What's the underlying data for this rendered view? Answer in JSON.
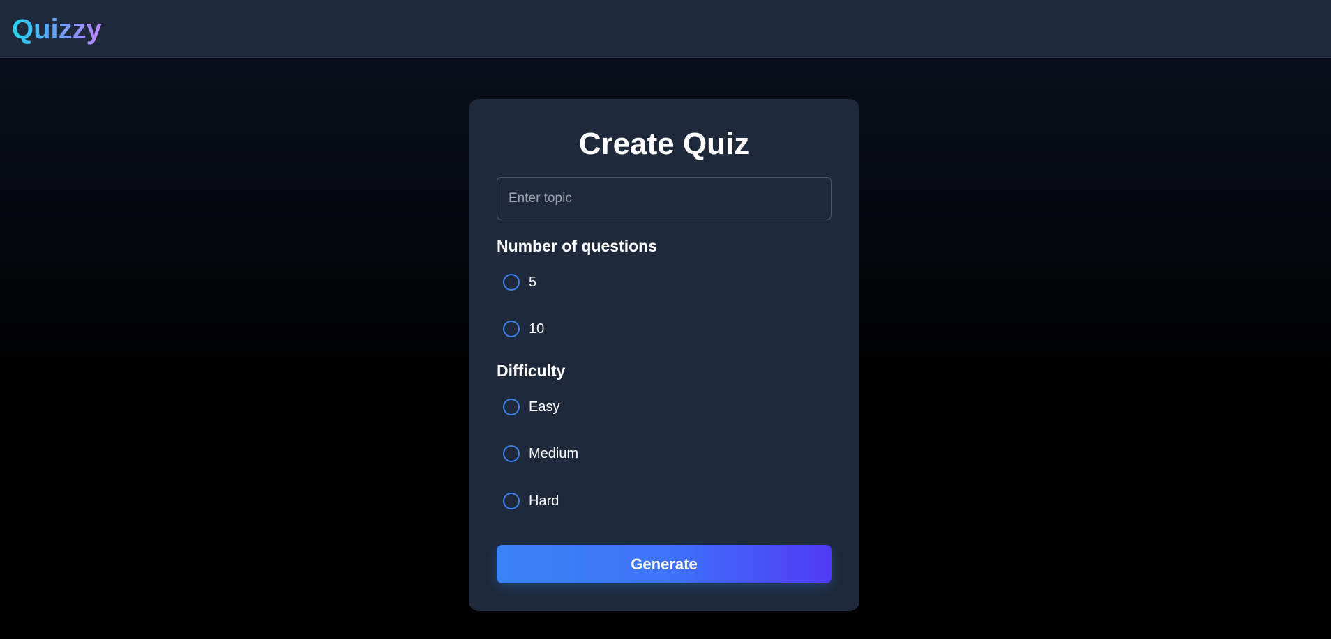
{
  "app": {
    "logo": "Quizzy"
  },
  "card": {
    "title": "Create Quiz",
    "topic_placeholder": "Enter topic",
    "topic_value": "",
    "questions_label": "Number of questions",
    "questions_options": [
      "5",
      "10"
    ],
    "difficulty_label": "Difficulty",
    "difficulty_options": [
      "Easy",
      "Medium",
      "Hard"
    ],
    "generate_label": "Generate"
  },
  "colors": {
    "accent": "#3b82f6",
    "card_bg": "#1e293b",
    "button_gradient_end": "#4f39f6"
  }
}
